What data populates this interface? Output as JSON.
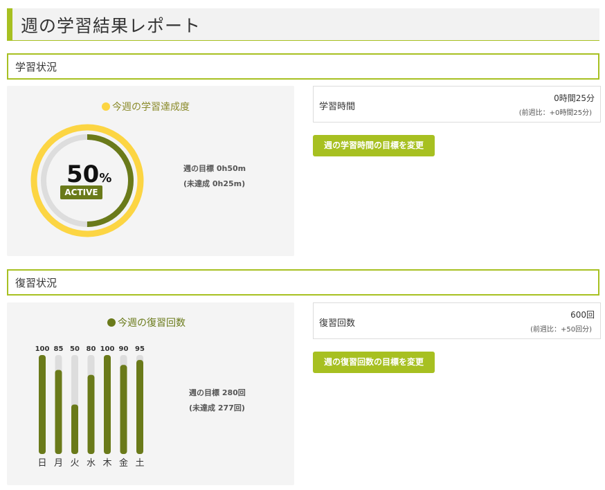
{
  "header": {
    "title": "週の学習結果レポート"
  },
  "study": {
    "section_title": "学習状況",
    "panel_title": "今週の学習達成度",
    "percent_value": "50",
    "percent_symbol": "%",
    "progress_fraction": 0.5,
    "badge": "ACTIVE",
    "goal_line1": "週の目標 0h50m",
    "goal_line2": "(未達成 0h25m)",
    "stat_label": "学習時間",
    "stat_value": "0時間25分",
    "stat_sub": "(前週比：+0時間25分)",
    "button_label": "週の学習時間の目標を変更"
  },
  "review": {
    "section_title": "復習状況",
    "panel_title": "今週の復習回数",
    "goal_line1": "週の目標 280回",
    "goal_line2": "(未達成 277回)",
    "stat_label": "復習回数",
    "stat_value": "600回",
    "stat_sub": "(前週比：+50回分)",
    "button_label": "週の復習回数の目標を変更"
  },
  "chart_data": {
    "type": "bar",
    "categories": [
      "日",
      "月",
      "火",
      "水",
      "木",
      "金",
      "土"
    ],
    "values": [
      100,
      85,
      50,
      80,
      100,
      90,
      95
    ],
    "ylim": [
      0,
      100
    ]
  },
  "colors": {
    "accent": "#a7c021",
    "dark_green": "#6a7a1a",
    "ring_yellow": "#fcd543",
    "track_gray": "#dddddd",
    "panel_bg": "#f4f4f4"
  }
}
